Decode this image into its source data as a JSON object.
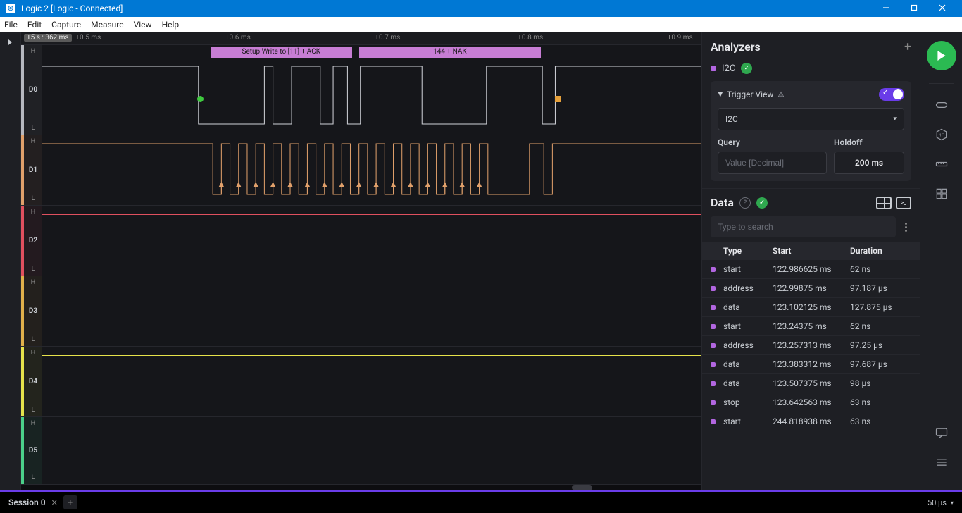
{
  "window": {
    "title": "Logic 2 [Logic - Connected]"
  },
  "menu": [
    "File",
    "Edit",
    "Capture",
    "Measure",
    "View",
    "Help"
  ],
  "timeline": {
    "abs_time": "+5 s : 362 ms",
    "ticks": [
      {
        "label": "+0.5 ms",
        "left_pct": 8
      },
      {
        "label": "+0.6 ms",
        "left_pct": 30
      },
      {
        "label": "+0.7 ms",
        "left_pct": 52
      },
      {
        "label": "+0.8 ms",
        "left_pct": 73
      },
      {
        "label": "+0.9 ms",
        "left_pct": 95
      }
    ]
  },
  "channels": [
    {
      "id": "D0",
      "color": "#d0d2d8"
    },
    {
      "id": "D1",
      "color": "#e0a06b"
    },
    {
      "id": "D2",
      "color": "#e0505f"
    },
    {
      "id": "D3",
      "color": "#e0b04b"
    },
    {
      "id": "D4",
      "color": "#e6e24b"
    },
    {
      "id": "D5",
      "color": "#4bd08a"
    }
  ],
  "protocol_annotations": [
    {
      "text": "Setup Write to [11] + ACK",
      "left_pct": 25.5,
      "width_pct": 21.5
    },
    {
      "text": "144 + NAK",
      "left_pct": 48.1,
      "width_pct": 27.5
    }
  ],
  "analyzers": {
    "title": "Analyzers",
    "name": "I2C",
    "trigger_view_label": "Trigger View",
    "trigger_select": "I2C",
    "query_label": "Query",
    "query_placeholder": "Value [Decimal]",
    "holdoff_label": "Holdoff",
    "holdoff_value": "200 ms"
  },
  "data_panel": {
    "title": "Data",
    "search_placeholder": "Type to search",
    "columns": [
      "Type",
      "Start",
      "Duration"
    ],
    "rows": [
      {
        "type": "start",
        "start": "122.986625 ms",
        "dur": "62 ns"
      },
      {
        "type": "address",
        "start": "122.99875 ms",
        "dur": "97.187 µs"
      },
      {
        "type": "data",
        "start": "123.102125 ms",
        "dur": "127.875 µs"
      },
      {
        "type": "start",
        "start": "123.24375 ms",
        "dur": "62 ns"
      },
      {
        "type": "address",
        "start": "123.257313 ms",
        "dur": "97.25 µs"
      },
      {
        "type": "data",
        "start": "123.383312 ms",
        "dur": "97.687 µs"
      },
      {
        "type": "data",
        "start": "123.507375 ms",
        "dur": "98 µs"
      },
      {
        "type": "stop",
        "start": "123.642563 ms",
        "dur": "63 ns"
      },
      {
        "type": "start",
        "start": "244.818938 ms",
        "dur": "63 ns"
      }
    ]
  },
  "session": {
    "name": "Session 0"
  },
  "zoom": {
    "value": "50 µs"
  }
}
